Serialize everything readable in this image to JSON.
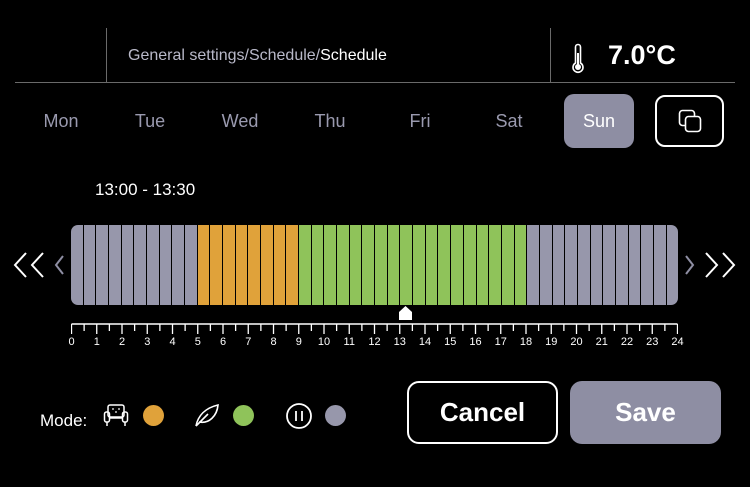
{
  "header": {
    "breadcrumb_path": "General settings/Schedule/",
    "breadcrumb_current": "Schedule",
    "temperature": "7.0°C",
    "thermometer_icon": "thermometer-icon"
  },
  "days": [
    {
      "label": "Mon",
      "active": false
    },
    {
      "label": "Tue",
      "active": false
    },
    {
      "label": "Wed",
      "active": false
    },
    {
      "label": "Thu",
      "active": false
    },
    {
      "label": "Fri",
      "active": false
    },
    {
      "label": "Sat",
      "active": false
    },
    {
      "label": "Sun",
      "active": true
    }
  ],
  "copy_icon": "copy-icon",
  "time_range": "13:00  -  13:30",
  "schedule": {
    "slot_minutes": 30,
    "slots_per_day": 48,
    "selected_slot": 26,
    "segments": [
      {
        "from_hour": 0,
        "to_hour": 5,
        "mode": "pause"
      },
      {
        "from_hour": 5,
        "to_hour": 9,
        "mode": "comfort"
      },
      {
        "from_hour": 9,
        "to_hour": 18,
        "mode": "eco"
      },
      {
        "from_hour": 18,
        "to_hour": 24,
        "mode": "pause"
      }
    ]
  },
  "ruler": {
    "labels": [
      "0",
      "1",
      "2",
      "3",
      "4",
      "5",
      "6",
      "7",
      "8",
      "9",
      "10",
      "11",
      "12",
      "13",
      "14",
      "15",
      "16",
      "17",
      "18",
      "19",
      "20",
      "21",
      "22",
      "23",
      "24"
    ]
  },
  "colors": {
    "comfort": "#e0a23a",
    "eco": "#8fc35a",
    "pause": "#9797ab",
    "accent": "#8e8ea3"
  },
  "mode_legend": {
    "label": "Mode:",
    "items": [
      {
        "icon": "armchair-icon",
        "mode": "comfort"
      },
      {
        "icon": "leaf-icon",
        "mode": "eco"
      },
      {
        "icon": "pause-icon",
        "mode": "pause"
      }
    ]
  },
  "buttons": {
    "cancel": "Cancel",
    "save": "Save"
  }
}
